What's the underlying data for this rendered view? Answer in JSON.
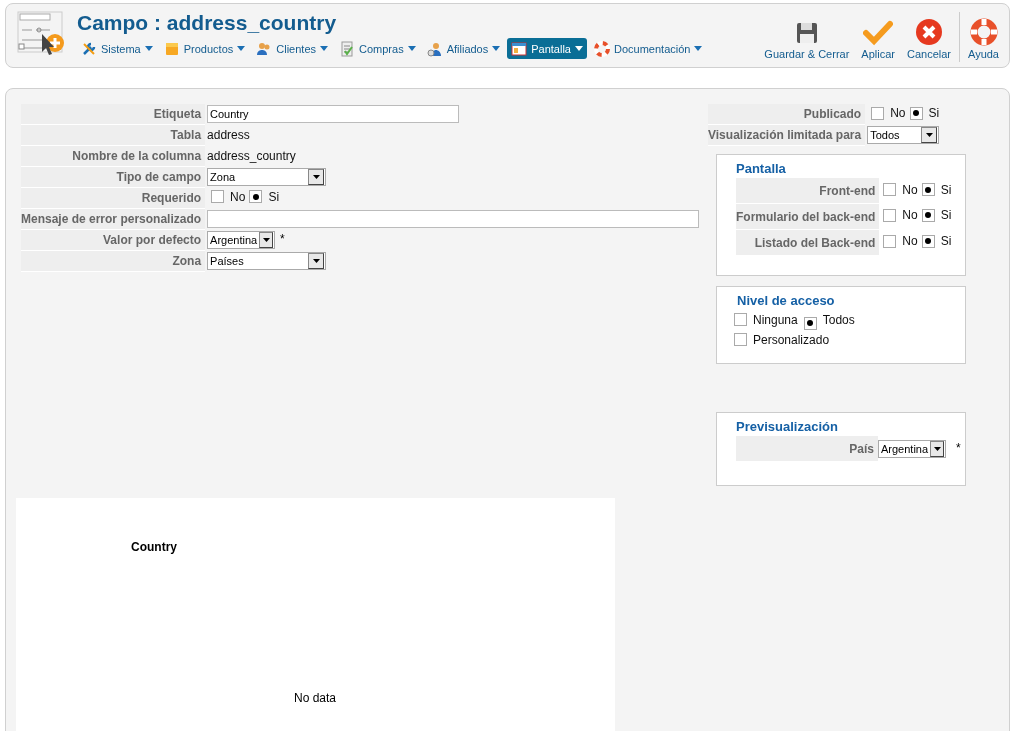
{
  "header": {
    "title": "Campo : address_country",
    "menu": [
      {
        "label": "Sistema",
        "selected": false
      },
      {
        "label": "Productos",
        "selected": false
      },
      {
        "label": "Clientes",
        "selected": false
      },
      {
        "label": "Compras",
        "selected": false
      },
      {
        "label": "Afiliados",
        "selected": false
      },
      {
        "label": "Pantalla",
        "selected": true
      },
      {
        "label": "Documentación",
        "selected": false
      }
    ],
    "toolbar": [
      {
        "label": "Guardar & Cerrar",
        "kind": "save"
      },
      {
        "label": "Aplicar",
        "kind": "apply"
      },
      {
        "label": "Cancelar",
        "kind": "cancel"
      },
      {
        "label": "Ayuda",
        "kind": "help"
      }
    ]
  },
  "form": [
    {
      "label": "Etiqueta",
      "kind": "text",
      "value": "Country"
    },
    {
      "label": "Tabla",
      "kind": "static",
      "value": "address"
    },
    {
      "label": "Nombre de la columna",
      "kind": "static",
      "value": "address_country"
    },
    {
      "label": "Tipo de campo",
      "kind": "select",
      "value": "Zona"
    },
    {
      "label": "Requerido",
      "kind": "radio",
      "options": [
        {
          "label": "No",
          "selected": false
        },
        {
          "label": "Si",
          "selected": true
        }
      ]
    },
    {
      "label": "Mensaje de error personalizado",
      "kind": "wide_text"
    },
    {
      "label": "Valor por defecto",
      "kind": "small_select",
      "value": "Argentina",
      "note": "*"
    },
    {
      "label": "Zona",
      "kind": "select",
      "value": "Países"
    }
  ],
  "publish": [
    {
      "label": "Publicado",
      "kind": "radio",
      "options": [
        {
          "label": "No",
          "selected": false
        },
        {
          "label": "Si",
          "selected": true
        }
      ]
    },
    {
      "label": "Visualización limitada para",
      "kind": "select",
      "value": "Todos"
    }
  ],
  "display_panel": {
    "title": "Pantalla",
    "rows": [
      {
        "label": "Front-end",
        "options": [
          {
            "label": "No",
            "selected": false
          },
          {
            "label": "Si",
            "selected": true
          }
        ]
      },
      {
        "label": "Formulario del back-end",
        "options": [
          {
            "label": "No",
            "selected": false
          },
          {
            "label": "Si",
            "selected": true
          }
        ]
      },
      {
        "label": "Listado del Back-end",
        "options": [
          {
            "label": "No",
            "selected": false
          },
          {
            "label": "Si",
            "selected": true
          }
        ]
      }
    ]
  },
  "access_panel": {
    "title": "Nivel de acceso",
    "options": [
      {
        "label": "Ninguna",
        "selected": false
      },
      {
        "label": "Todos",
        "selected": true
      },
      {
        "label": "Personalizado",
        "selected": false
      }
    ]
  },
  "preview_panel": {
    "title": "Previsualización",
    "label": "País",
    "value": "Argentina",
    "note": "*"
  },
  "chart": {
    "title": "Country",
    "message": "No data"
  }
}
